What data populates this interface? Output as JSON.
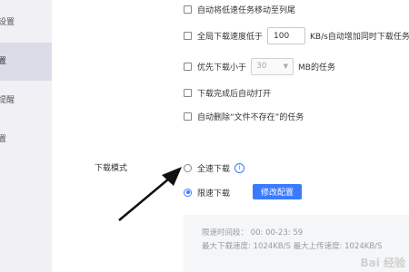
{
  "sidebar": {
    "items": [
      {
        "label": "设置"
      },
      {
        "label": "置",
        "active": true
      },
      {
        "label": "提醒"
      },
      {
        "label": "置"
      }
    ]
  },
  "options": {
    "move_slow": "自动将低速任务移动至列尾",
    "global_speed_prefix": "全局下载速度低于",
    "global_speed_value": "100",
    "global_speed_suffix": "KB/s自动增加同时下载任务",
    "priority_prefix": "优先下载小于",
    "priority_value": "30",
    "priority_suffix": "MB的任务",
    "open_after": "下载完成后自动打开",
    "auto_delete": "自动删除“文件不存在”的任务"
  },
  "download_mode": {
    "label": "下载模式",
    "full_speed": "全速下载",
    "limited": "限速下载",
    "selected": "limited",
    "edit_button": "修改配置"
  },
  "limit_panel": {
    "period": "限速时间段：  00: 00-23: 59",
    "speeds": "最大下载速度: 1024KB/S    最大上传速度: 1024KB/S"
  },
  "colors": {
    "accent": "#3a7afe",
    "sidebar_bg": "#f1f1f5",
    "sidebar_active": "#dcdce8",
    "arrow": "#111111"
  },
  "watermark": "Bai 经验"
}
